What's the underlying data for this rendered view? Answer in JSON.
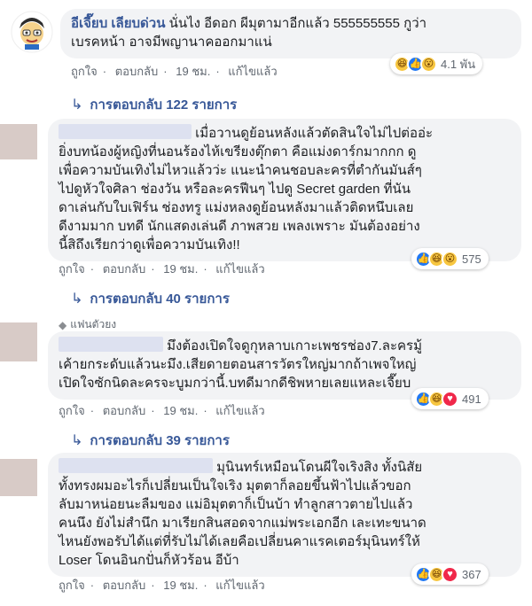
{
  "comments": [
    {
      "author": "อีเจี๊ยบ เลียบด่วน",
      "lines": [
        "นั่นไง อีดอก ผีมุตามาอีกแล้ว 555555555 กูว่า",
        "เบรคหน้า อาจมีพญานาคออกมาแน่"
      ],
      "actions": {
        "like": "ถูกใจ",
        "reply": "ตอบกลับ",
        "time": "19 ชม.",
        "edited": "แก้ไขแล้ว"
      },
      "reactions": {
        "icons": [
          "haha-icon",
          "like-icon",
          "wow-icon"
        ],
        "count": "4.1 พัน"
      },
      "replies_link": "การตอบกลับ 122 รายการ"
    },
    {
      "lines": [
        "เมื่อวานดูย้อนหลังแล้วตัดสินใจไม่ไปต่ออ่ะ",
        "ยิ่งบทน้องผู้หญิงที่นอนร้องไห้เขรียงตุ๊กตา คือแม่งดาร์กมากกก ดู",
        "เพื่อความบันเทิงไม่ไหวแล้วว่ะ แนะนำคนชอบละครที่ตำกันมันส์ๆ",
        "ไปดูหัวใจศิลา ช่องวัน หรือละครฟีนๆ ไปดู Secret garden ที่นัน",
        "ดาเล่นกับใบเฟิร์น ช่องทรู แม่งหลงดูย้อนหลังมาแล้วติดหนึบเลย",
        "ดีงามมาก บทดี นักแสดงเล่นดี ภาพสวย เพลงเพราะ มันต้องอย่าง",
        "นี้สิถึงเรียกว่าดูเพื่อความบันเทิง!!"
      ],
      "actions": {
        "like": "ถูกใจ",
        "reply": "ตอบกลับ",
        "time": "19 ชม.",
        "edited": "แก้ไขแล้ว"
      },
      "reactions": {
        "icons": [
          "like-icon",
          "haha-icon",
          "wow-icon"
        ],
        "count": "575"
      },
      "replies_link": "การตอบกลับ 40 รายการ"
    },
    {
      "badge": "แฟนตัวยง",
      "lines": [
        "มึงต้องเปิดใจดูกุหลาบเกาะเพชรช่อง7.ละครมู้",
        "เค้ายกระดับแล้วนะมึง.เสียดายตอนสารวัตรใหญ่มากถ้าเพจใหญ่",
        "เปิดใจซักนิดละครจะบูมกว่านี้.บทดีมากดีชิพหายเลยแหละเจี๊ยบ"
      ],
      "actions": {
        "like": "ถูกใจ",
        "reply": "ตอบกลับ",
        "time": "19 ชม.",
        "edited": "แก้ไขแล้ว"
      },
      "reactions": {
        "icons": [
          "like-icon",
          "haha-icon",
          "love-icon"
        ],
        "count": "491"
      },
      "replies_link": "การตอบกลับ 39 รายการ"
    },
    {
      "lines": [
        "มุนินทร์เหมือนโดนผีใจเริงสิง ทั้งนิสัย",
        "ทั้งทรงผมอะไรก็เปลี่ยนเป็นใจเริง มุตตาก็ลอยขึ้นฟ้าไปแล้วขอก",
        "ลับมาหน่อยนะลืมของ แม่อิมุตตาก็เป็นบ้า ทำลูกสาวตายไปแล้ว",
        "คนนึง ยังไม่สำนึก มาเรียกสินสอดจากแม่พระเอกอีก เละเทะขนาด",
        "ไหนยังพอรับได้แต่ที่รับไม่ได้เลยคือเปลี่ยนคาแรคเตอร์มุนินทร์ให้",
        "Loser โดนอินกปั่นก็หัวร้อน อีบ้า"
      ],
      "actions": {
        "like": "ถูกใจ",
        "reply": "ตอบกลับ",
        "time": "19 ชม.",
        "edited": "แก้ไขแล้ว"
      },
      "reactions": {
        "icons": [
          "like-icon",
          "haha-icon",
          "love-icon"
        ],
        "count": "367"
      }
    }
  ]
}
